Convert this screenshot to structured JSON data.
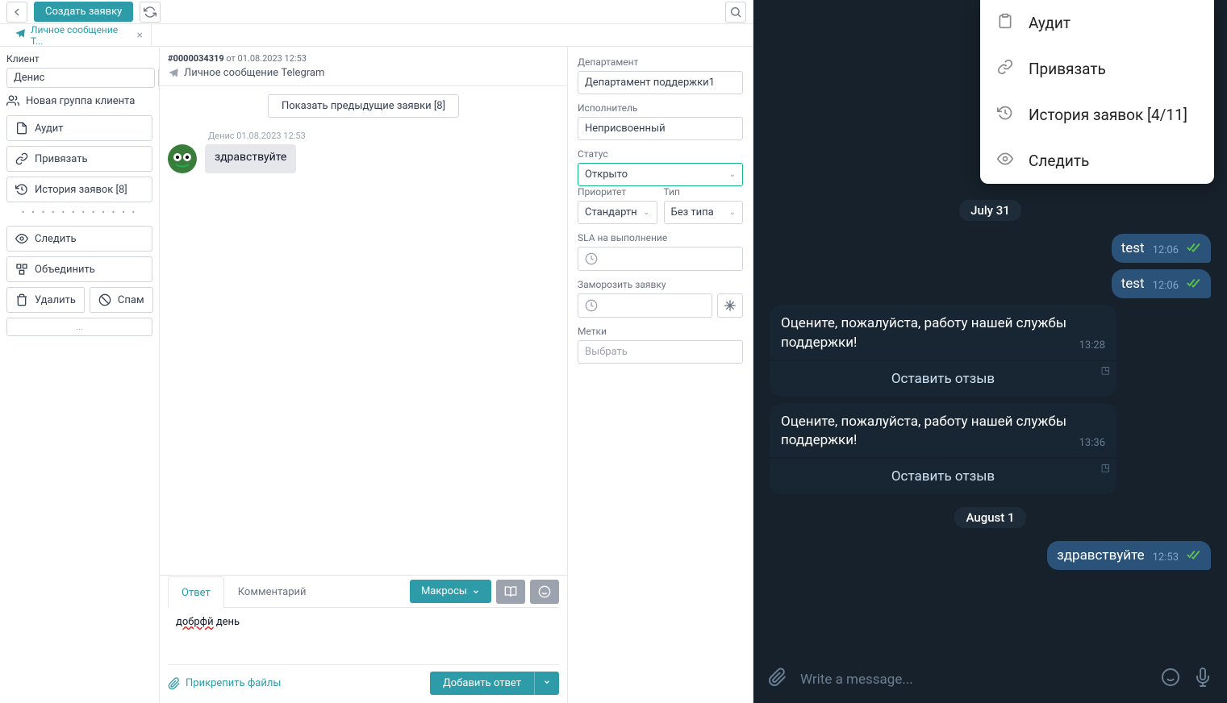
{
  "header": {
    "create_ticket": "Создать заявку"
  },
  "tab": {
    "title": "Личное сообщение Т..."
  },
  "sidebar": {
    "client_label": "Клиент",
    "client_name": "Денис",
    "new_group": "Новая группа клиента",
    "audit": "Аудит",
    "link": "Привязать",
    "history": "История заявок [8]",
    "follow": "Следить",
    "merge": "Объединить",
    "delete": "Удалить",
    "spam": "Спам",
    "more": "..."
  },
  "conversation": {
    "ticket_id": "#0000034319",
    "ticket_meta": "от 01.08.2023 12:53",
    "title": "Личное сообщение Telegram",
    "prev_tickets": "Показать предыдущие заявки [8]",
    "msg_meta": "Денис 01.08.2023 12:53",
    "msg_text": "здравствуйте"
  },
  "reply": {
    "tab_reply": "Ответ",
    "tab_comment": "Комментарий",
    "macros": "Макросы",
    "text_spell": "добрфй",
    "text_rest": " день",
    "attach": "Прикрепить файлы",
    "send": "Добавить ответ"
  },
  "props": {
    "department_label": "Департамент",
    "department": "Департамент поддержки1",
    "assignee_label": "Исполнитель",
    "assignee": "Неприсвоенный",
    "status_label": "Статус",
    "status": "Открыто",
    "priority_label": "Приоритет",
    "priority": "Стандартн",
    "type_label": "Тип",
    "type": "Без типа",
    "sla_label": "SLA на выполнение",
    "freeze_label": "Заморозить заявку",
    "tags_label": "Метки",
    "tags_placeholder": "Выбрать"
  },
  "telegram": {
    "menu": {
      "audit": "Аудит",
      "link": "Привязать",
      "history": "История заявок [4/11]",
      "follow": "Следить"
    },
    "date1": "July 31",
    "out1": {
      "text": "test",
      "time": "12:06"
    },
    "out2": {
      "text": "test",
      "time": "12:06"
    },
    "rate1": {
      "text": "Оцените, пожалуйста, работу нашей службы поддержки!",
      "time": "13:28",
      "btn": "Оставить отзыв"
    },
    "rate2": {
      "text": "Оцените, пожалуйста, работу нашей службы поддержки!",
      "time": "13:36",
      "btn": "Оставить отзыв"
    },
    "date2": "August 1",
    "out3": {
      "text": "здравствуйте",
      "time": "12:53"
    },
    "input_placeholder": "Write a message..."
  }
}
